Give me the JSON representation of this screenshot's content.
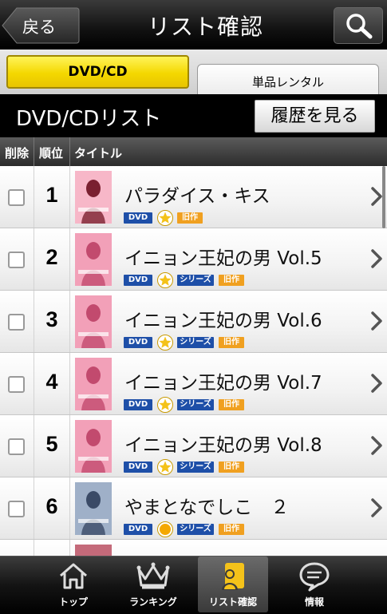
{
  "header": {
    "back_label": "戻る",
    "title": "リスト確認",
    "search_icon": "search-icon"
  },
  "tabs": [
    {
      "label": "DVD/CD",
      "active": true
    },
    {
      "label": "単品レンタル",
      "active": false
    }
  ],
  "list_bar": {
    "title": "DVD/CDリスト",
    "history_button": "履歴を見る"
  },
  "columns": {
    "delete": "削除",
    "rank": "順位",
    "title": "タイトル"
  },
  "rows": [
    {
      "rank": "1",
      "title": "パラダイス・キス",
      "badges": [
        "DVD",
        "star",
        "旧作"
      ],
      "star_color": "#f4c21a"
    },
    {
      "rank": "2",
      "title": "イニョン王妃の男 Vol.5",
      "badges": [
        "DVD",
        "star",
        "シリーズ",
        "旧作"
      ],
      "star_color": "#f4c21a"
    },
    {
      "rank": "3",
      "title": "イニョン王妃の男 Vol.6",
      "badges": [
        "DVD",
        "star",
        "シリーズ",
        "旧作"
      ],
      "star_color": "#f4c21a"
    },
    {
      "rank": "4",
      "title": "イニョン王妃の男 Vol.7",
      "badges": [
        "DVD",
        "star",
        "シリーズ",
        "旧作"
      ],
      "star_color": "#f4c21a"
    },
    {
      "rank": "5",
      "title": "イニョン王妃の男 Vol.8",
      "badges": [
        "DVD",
        "star",
        "シリーズ",
        "旧作"
      ],
      "star_color": "#f4c21a"
    },
    {
      "rank": "6",
      "title": "やまとなでしこ　２",
      "badges": [
        "DVD",
        "circle",
        "シリーズ",
        "旧作"
      ],
      "star_color": "#f4a800"
    }
  ],
  "badge_labels": {
    "dvd": "DVD",
    "series": "シリーズ",
    "old": "旧作"
  },
  "bottom_nav": [
    {
      "label": "トップ",
      "icon": "home-icon",
      "active": false
    },
    {
      "label": "ランキング",
      "icon": "crown-icon",
      "active": false
    },
    {
      "label": "リスト確認",
      "icon": "list-person-icon",
      "active": true
    },
    {
      "label": "情報",
      "icon": "speech-bubble-icon",
      "active": false
    }
  ],
  "colors": {
    "tab_active": "#f4d800",
    "badge_blue": "#1e4fa8",
    "badge_orange": "#f0a020",
    "nav_active_icon": "#f4c21a"
  }
}
